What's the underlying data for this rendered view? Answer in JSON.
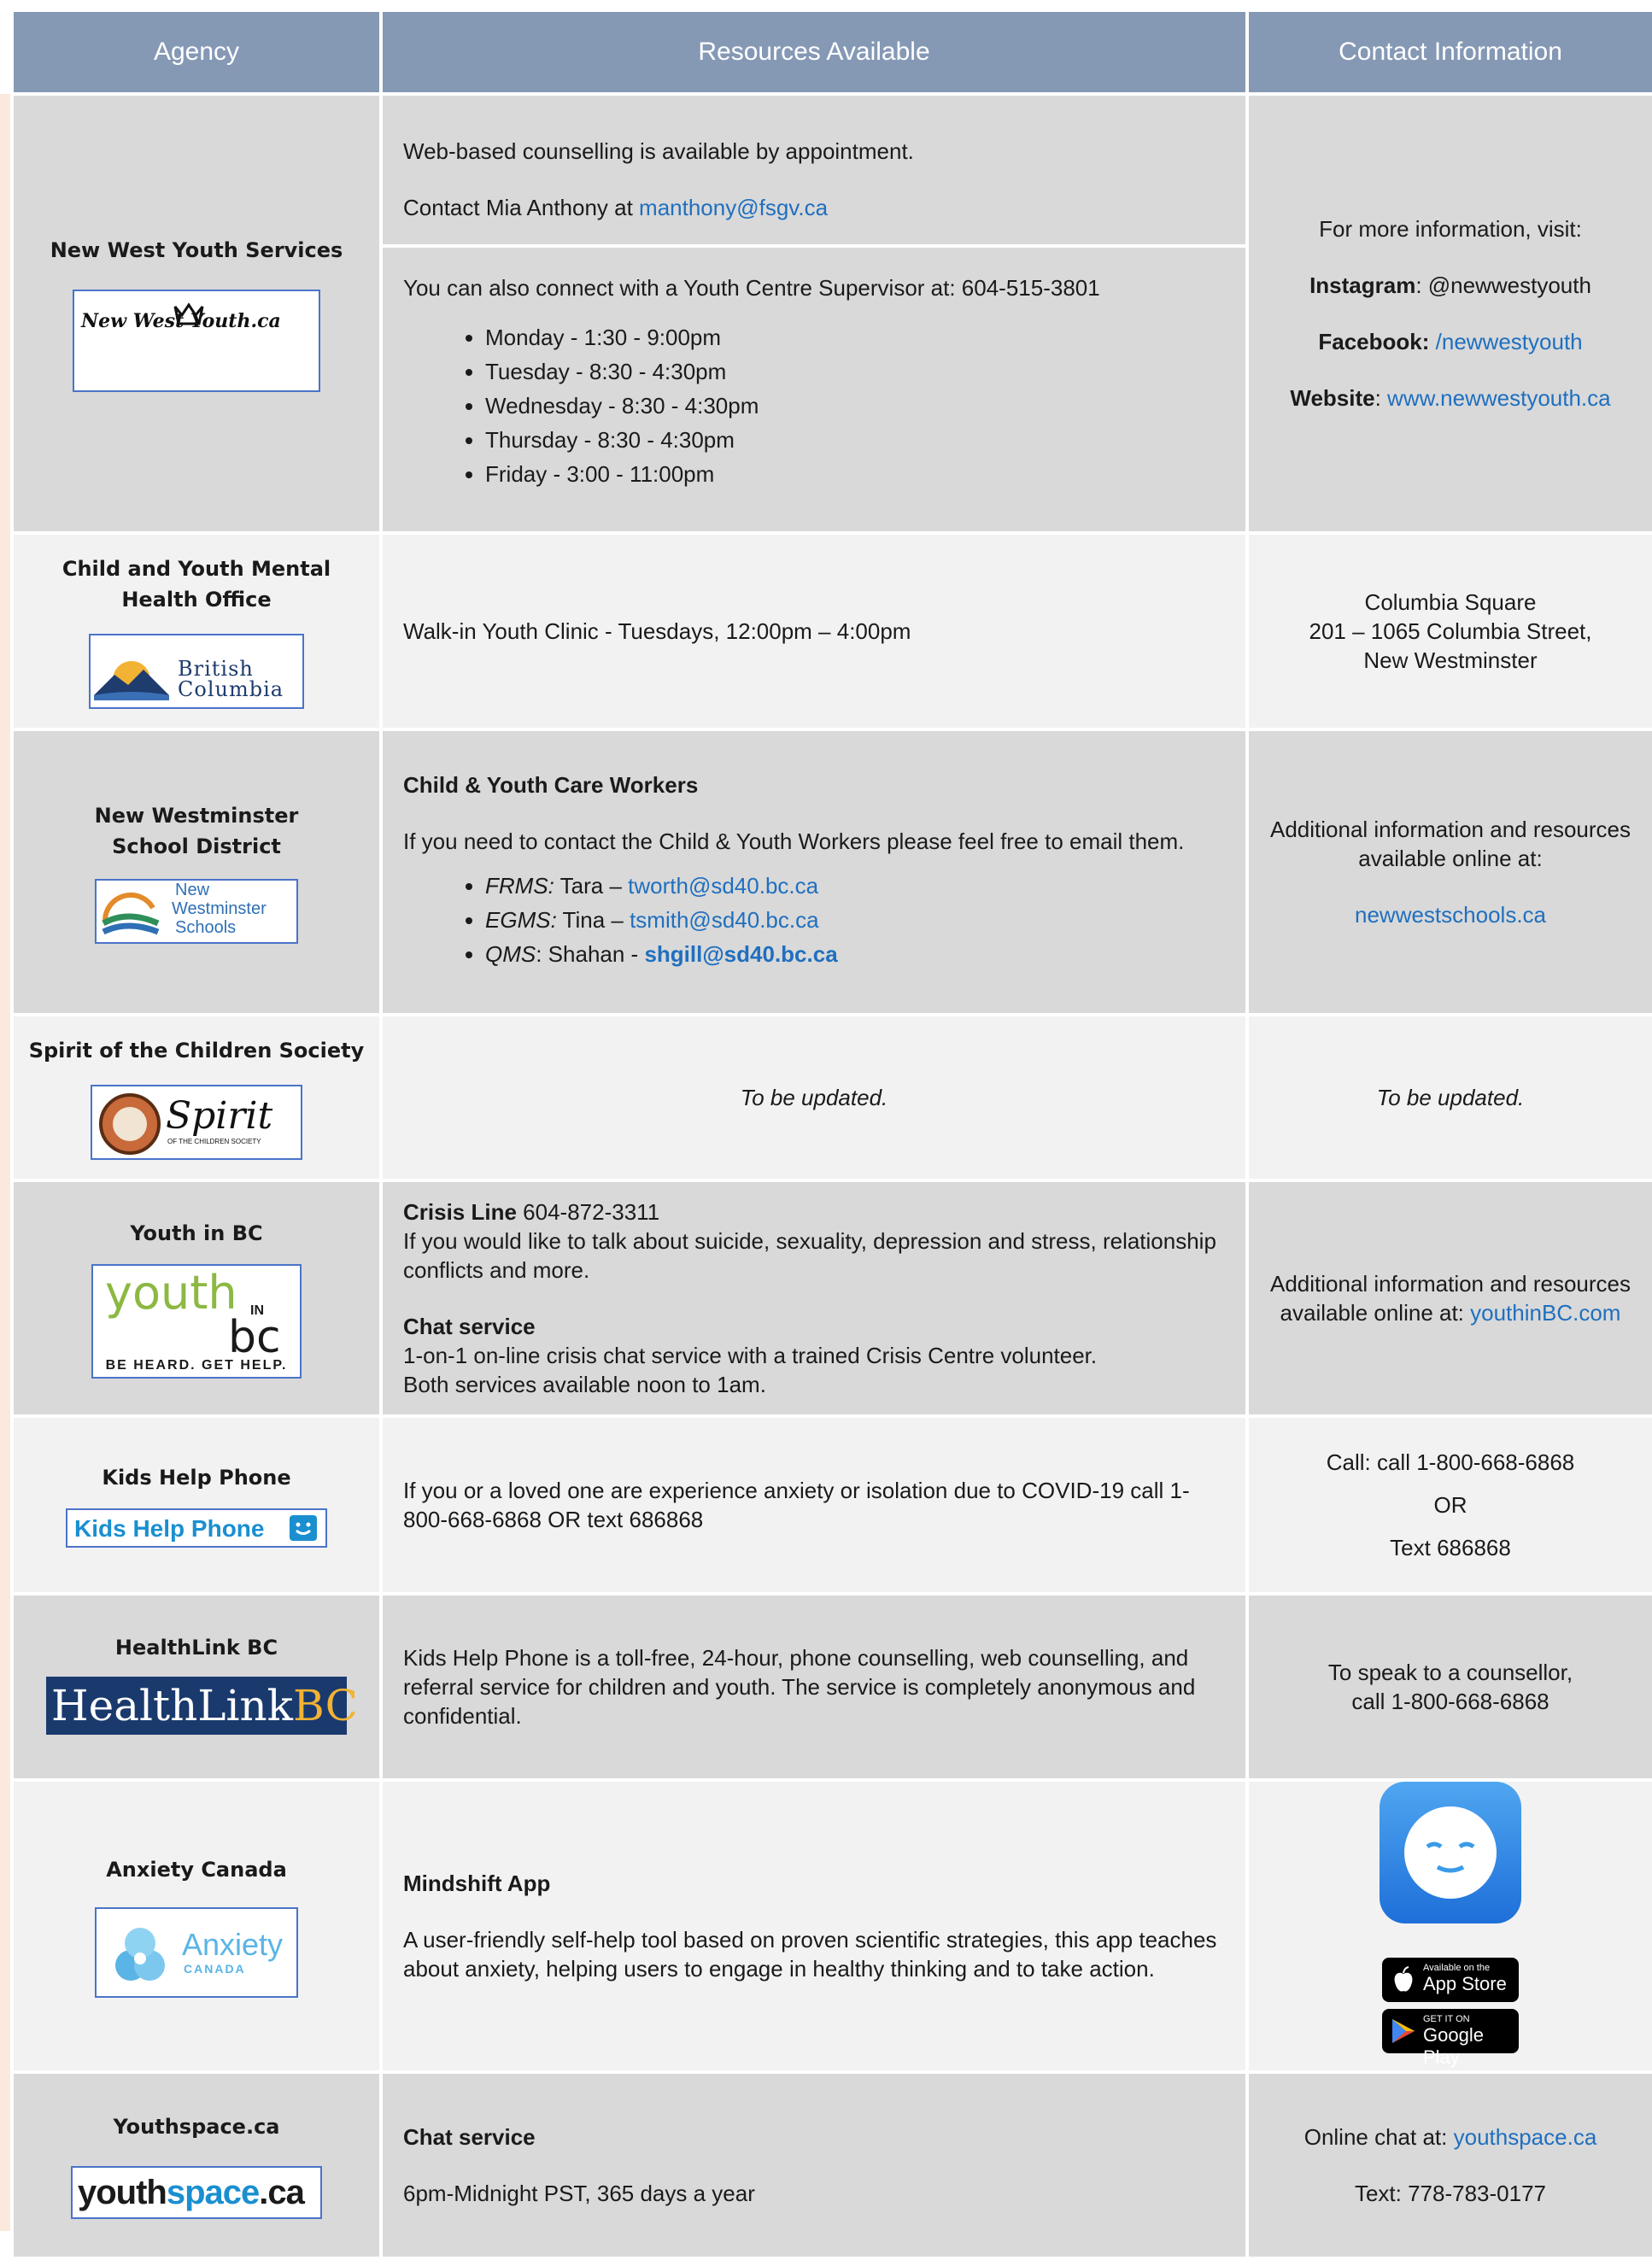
{
  "header": {
    "agency": "Agency",
    "resources": "Resources Available",
    "contact": "Contact Information"
  },
  "rows": [
    {
      "agency": "New West Youth Services",
      "logo_text": "New West Youth.ca",
      "res_a1": "Web-based counselling is available by appointment.",
      "res_a2_pre": "Contact Mia Anthony at ",
      "res_a2_link": "manthony@fsgv.ca",
      "res_b1": "You can also connect with a Youth Centre Supervisor at: 604-515-3801",
      "hours": [
        "Monday - 1:30 - 9:00pm",
        "Tuesday - 8:30 - 4:30pm",
        "Wednesday - 8:30 - 4:30pm",
        "Thursday - 8:30 - 4:30pm",
        "Friday - 3:00 - 11:00pm"
      ],
      "c_intro": "For more information, visit:",
      "c_ig_label": "Instagram",
      "c_ig": ": @newwestyouth",
      "c_fb_label": "Facebook:",
      "c_fb": "/newwestyouth",
      "c_web_label": "Website",
      "c_web_sep": ": ",
      "c_web": "www.newwestyouth.ca"
    },
    {
      "agency": "Child and Youth Mental Health Office",
      "logo_text_1": "British",
      "logo_text_2": "Columbia",
      "res": "Walk-in Youth Clinic - Tuesdays, 12:00pm – 4:00pm",
      "c1": "Columbia Square",
      "c2": "201 – 1065 Columbia Street,",
      "c3": "New Westminster"
    },
    {
      "agency_1": "New Westminster",
      "agency_2": "School District",
      "logo_text_1": "New",
      "logo_text_2": "Westminster",
      "logo_text_3": "Schools",
      "res_title": "Child & Youth Care Workers",
      "res_intro": "If you need to contact the Child & Youth Workers please feel free to email them.",
      "workers": [
        {
          "school": "FRMS:",
          "name": " Tara – ",
          "email": "tworth@sd40.bc.ca"
        },
        {
          "school": "EGMS:",
          "name": " Tina – ",
          "email": "tsmith@sd40.bc.ca"
        },
        {
          "school": "QMS",
          "name": ": Shahan - ",
          "email": "shgill@sd40.bc.ca"
        }
      ],
      "c1": "Additional information and resources available online at:",
      "c_link": "newwestschools.ca"
    },
    {
      "agency": "Spirit of the Children Society",
      "logo_text": "Spirit",
      "logo_sub": "OF THE CHILDREN SOCIETY",
      "res": "To be updated.",
      "contact": "To be updated."
    },
    {
      "agency": "Youth in BC",
      "logo_youth": "youth",
      "logo_in": "IN",
      "logo_bc": "bc",
      "logo_tag": "BE HEARD. GET HELP.",
      "crisis_label": "Crisis Line",
      "crisis_num": " 604-872-3311",
      "crisis_desc": "If you would like to talk about suicide, sexuality, depression and stress, relationship conflicts and more.",
      "chat_title": "Chat service",
      "chat_1": "1-on-1 on-line crisis chat service with a trained Crisis Centre volunteer.",
      "chat_2": "Both services available noon to 1am.",
      "c1": "Additional information and resources available online at:  ",
      "c_link": "youthinBC.com"
    },
    {
      "agency": "Kids Help Phone",
      "logo_text": "Kids Help Phone",
      "res": "If you or a loved one are experience anxiety or isolation due to COVID-19 call 1-800-668-6868 OR text 686868",
      "c1": "Call: call 1-800-668-6868",
      "c2": "OR",
      "c3": "Text 686868"
    },
    {
      "agency": "HealthLink BC",
      "logo_a": "HealthLink",
      "logo_b": "BC",
      "res": "Kids Help Phone is a toll-free, 24-hour, phone counselling, web counselling, and referral service for children and youth. The service is completely anonymous and confidential.",
      "c1": "To speak to a counsellor,",
      "c2": "call 1-800-668-6868"
    },
    {
      "agency": "Anxiety Canada",
      "logo_a": "Anxiety",
      "logo_b": "CANADA",
      "res_title": "Mindshift App",
      "res": "A user-friendly self-help tool based on proven scientific strategies, this app teaches about anxiety, helping users to engage in healthy thinking and to take action.",
      "appstore_small": "Available on the",
      "appstore_big": "App Store",
      "gplay_small": "GET IT ON",
      "gplay_big": "Google Play"
    },
    {
      "agency": "Youthspace.ca",
      "logo_a": "youth",
      "logo_b": "space",
      "logo_c": ".ca",
      "res_title": "Chat service",
      "res": "6pm-Midnight PST, 365 days a year",
      "c1_pre": "Online chat at: ",
      "c1_link": "youthspace.ca",
      "c2": "Text: 778-783-0177"
    }
  ],
  "colors": {
    "header": "#8599b5",
    "dark_row": "#d9d9d9",
    "light_row": "#f2f2f2",
    "link": "#1f6fbf"
  }
}
